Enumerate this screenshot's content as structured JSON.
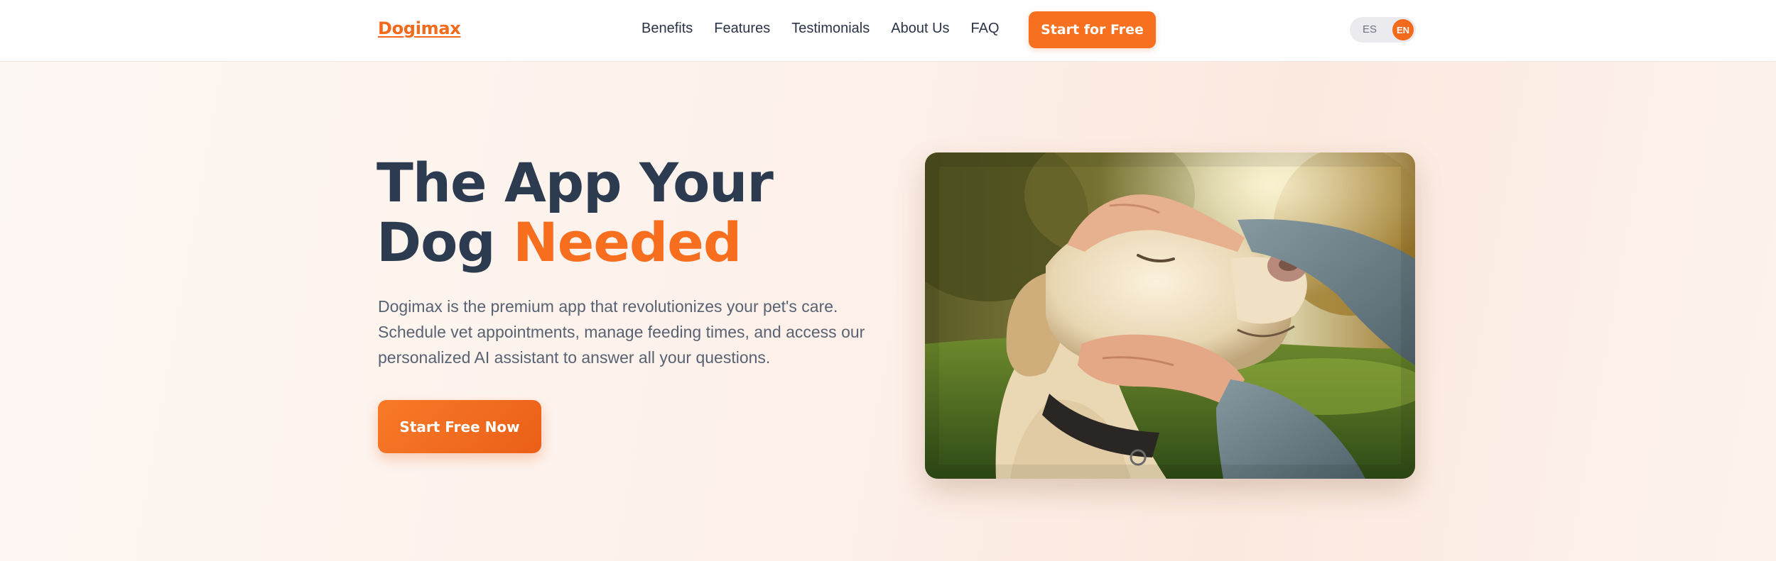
{
  "header": {
    "logo": "Dogimax",
    "nav": [
      "Benefits",
      "Features",
      "Testimonials",
      "About Us",
      "FAQ"
    ],
    "cta_label": "Start for Free",
    "lang": {
      "es": "ES",
      "en": "EN",
      "active": "EN"
    }
  },
  "hero": {
    "title_line1": "The App Your",
    "title_line2_plain": "Dog",
    "title_line2_accent": "Needed",
    "description": "Dogimax is the premium app that revolutionizes your pet's care. Schedule vet appointments, manage feeding times, and access our personalized AI assistant to answer all your questions.",
    "cta_label": "Start Free Now"
  },
  "colors": {
    "brand": "#f26a1b",
    "heading": "#2c3b50",
    "body_text": "#586273",
    "background": "#fdf4ee"
  }
}
